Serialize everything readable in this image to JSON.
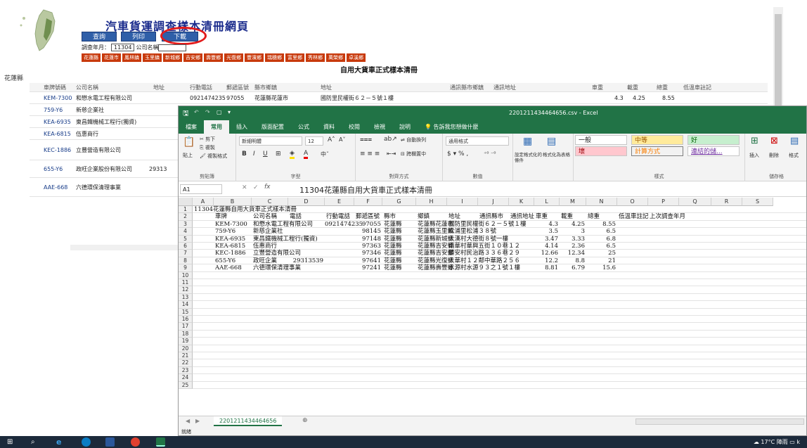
{
  "web": {
    "title": "汽車貨運調查樣本清冊網頁",
    "buttons": {
      "query": "查詢",
      "print": "列印",
      "download": "下載"
    },
    "filter_label": "調查年月：",
    "filter_value": "11304",
    "company_label": "公司名稱",
    "counties": [
      "花蓮縣",
      "花蓮市",
      "鳳林鎮",
      "玉里鎮",
      "新城鄉",
      "吉安鄉",
      "壽豐鄉",
      "光復鄉",
      "豐濱鄉",
      "瑞穗鄉",
      "富里鄉",
      "秀林鄉",
      "萬榮鄉",
      "卓溪鄉"
    ],
    "list_title": "自用大貨車正式樣本清冊",
    "county_label": "花蓮縣",
    "table_headers": [
      "車牌號碼",
      "公司名稱",
      "地址",
      "行動電話",
      "郵遞區號",
      "縣市鄉鎮",
      "地址",
      "通訊縣市鄉鎮",
      "通訊地址",
      "車重",
      "載重",
      "總重",
      "低溫車註記"
    ],
    "rows": [
      {
        "plate": "KEM-7300",
        "company": "和懋水電工程有限公司",
        "addr": "",
        "mobile": "0921474235",
        "zip": "97055",
        "town": "花蓮縣花蓮市",
        "street": "國防里民權街６２－５號１樓",
        "w": "4.3",
        "load": "4.25",
        "total": "8.55"
      },
      {
        "plate": "759-Y6",
        "company": "新慈企業社",
        "addr": "",
        "mobile": "",
        "zip": "",
        "town": "",
        "street": "",
        "w": "",
        "load": "",
        "total": ""
      },
      {
        "plate": "KEA-6935",
        "company": "東昌鐵機械工程行(獨資)",
        "addr": "",
        "mobile": "",
        "zip": "",
        "town": "",
        "street": "",
        "w": "",
        "load": "",
        "total": ""
      },
      {
        "plate": "KEA-6815",
        "company": "伍惠商行",
        "addr": "",
        "mobile": "",
        "zip": "",
        "town": "",
        "street": "",
        "w": "",
        "load": "",
        "total": ""
      },
      {
        "plate": "KEC-1886",
        "company": "立豐營造有限公司",
        "addr": "",
        "mobile": "",
        "zip": "",
        "town": "",
        "street": "",
        "w": "",
        "load": "",
        "total": ""
      },
      {
        "plate": "655-Y6",
        "company": "政旺企業股份有限公司",
        "addr": "",
        "mobile": "29313",
        "zip": "",
        "town": "",
        "street": "",
        "w": "",
        "load": "",
        "total": ""
      },
      {
        "plate": "AAE-668",
        "company": "六德環保清理事業",
        "addr": "",
        "mobile": "",
        "zip": "",
        "town": "",
        "street": "",
        "w": "",
        "load": "",
        "total": ""
      }
    ]
  },
  "excel": {
    "file_title": "220121143446​4656.csv  -  Excel",
    "tabs": [
      "檔案",
      "常用",
      "插入",
      "版面配置",
      "公式",
      "資料",
      "校閱",
      "檢視",
      "說明"
    ],
    "tell_me": "告訴我您想做什麼",
    "ribbon": {
      "paste": "貼上",
      "cut": "剪下",
      "copy": "複製",
      "format_painter": "複製格式",
      "clipboard": "剪貼簿",
      "font_name": "新細明體",
      "font_size": "12",
      "font_group": "字型",
      "wrap": "自動換列",
      "merge": "跨欄置中",
      "align_group": "對齊方式",
      "number_format": "通用格式",
      "number_group": "數值",
      "cond_format": "設定格式化的條件",
      "format_table": "格式化為表格",
      "style_normal": "一般",
      "style_neutral": "中等",
      "style_good": "好",
      "style_bad": "壞",
      "style_calc": "計算方式",
      "style_link": "連結的儲...",
      "styles_group": "樣式",
      "insert": "插入",
      "delete": "刪除",
      "format": "格式",
      "cells_group": "儲存格"
    },
    "name_box": "A1",
    "formula": "11304花蓮縣自用大貨車正式樣本清冊",
    "columns": [
      "A",
      "B",
      "C",
      "D",
      "E",
      "F",
      "G",
      "H",
      "I",
      "J",
      "K",
      "L",
      "M",
      "N",
      "O",
      "P",
      "Q",
      "R",
      "S"
    ],
    "row_numbers": [
      "1",
      "2",
      "3",
      "4",
      "5",
      "6",
      "7",
      "8",
      "9",
      "10",
      "11",
      "12",
      "13",
      "14",
      "15",
      "16",
      "17",
      "18",
      "19",
      "20",
      "21",
      "22",
      "23",
      "24",
      "25"
    ],
    "a1": "11304花蓮縣自用大貨車正式樣本清冊",
    "header_row": [
      "車牌",
      "公司名稱",
      "電話",
      "行動電話",
      "郵遞區號",
      "縣市",
      "鄉鎮",
      "地址",
      "通訊縣市",
      "通訊地址",
      "車重",
      "載重",
      "總重",
      "低溫車註記",
      "上次調查年月"
    ],
    "data_rows": [
      [
        "KEM-7300",
        "和懋水電工程有限公司",
        "",
        "0921474235",
        "97055",
        "花蓮縣",
        "花蓮縣花蓮市",
        "國防里民權街６２－５號１樓",
        "",
        "",
        "4.3",
        "4.25",
        "8.55"
      ],
      [
        "759-Y6",
        "新慈企業社",
        "",
        "",
        "98145",
        "花蓮縣",
        "花蓮縣玉里鎮",
        "松浦里松浦３８號",
        "",
        "",
        "3.5",
        "3",
        "6.5"
      ],
      [
        "KEA-6935",
        "東昌鐵機械工程行(獨資)",
        "",
        "",
        "97148",
        "花蓮縣",
        "花蓮縣新城鄉",
        "大漢村大德街８號一樓",
        "",
        "",
        "3.47",
        "3.33",
        "6.8"
      ],
      [
        "KEA-6815",
        "伍惠商行",
        "",
        "",
        "97363",
        "花蓮縣",
        "花蓮縣吉安鄉",
        "南華村華興五街１０巷１２",
        "",
        "",
        "4.14",
        "2.36",
        "6.5"
      ],
      [
        "KEC-1886",
        "立豐營造有限公司",
        "",
        "",
        "97346",
        "花蓮縣",
        "花蓮縣吉安鄉",
        "勝安村民治路３３６巷２９",
        "",
        "",
        "12.66",
        "12.34",
        "25"
      ],
      [
        "655-Y6",
        "政旺企業",
        "29313539",
        "",
        "97641",
        "花蓮縣",
        "花蓮縣光復鄉",
        "大華村１２鄰中華路２５６",
        "",
        "",
        "12.2",
        "8.8",
        "21"
      ],
      [
        "AAE-668",
        "六德環保清理事業",
        "",
        "",
        "97241",
        "花蓮縣",
        "花蓮縣壽豐鄉",
        "水源村水源９３之１號１樓",
        "",
        "",
        "8.81",
        "6.79",
        "15.6"
      ]
    ],
    "sheet_tab": "220121143446​4656",
    "status": "就緒"
  },
  "taskbar": {
    "weather": "17°C 陣雨"
  }
}
